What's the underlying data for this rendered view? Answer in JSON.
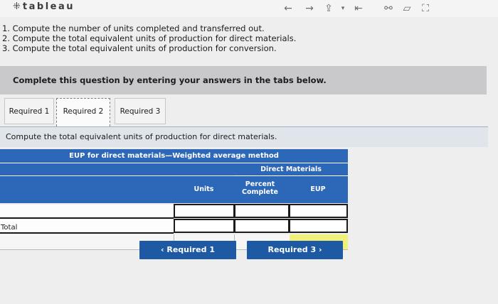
{
  "toolbar": {
    "brand": "tableau",
    "icons": [
      "back-arrow-icon",
      "forward-arrow-icon",
      "share-icon",
      "dropdown-icon",
      "collapse-icon",
      "collaborate-icon",
      "comment-icon",
      "fullscreen-icon"
    ]
  },
  "instructions": {
    "items": [
      "1. Compute the number of units completed and transferred out.",
      "2. Compute the total equivalent units of production for direct materials.",
      "3. Compute the total equivalent units of production for conversion."
    ]
  },
  "banner": {
    "text": "Complete this question by entering your answers in the tabs below."
  },
  "tabs": [
    {
      "label": "Required 1"
    },
    {
      "label": "Required 2"
    },
    {
      "label": "Required 3"
    }
  ],
  "task": {
    "text": "Compute the total equivalent units of production for direct materials."
  },
  "table": {
    "title": "EUP for direct materials—Weighted average method",
    "group_header": "Direct Materials",
    "columns": {
      "units": "Units",
      "percent": "Percent Complete",
      "eup": "EUP"
    },
    "total_label": "Total",
    "colors": {
      "header": "#2c67b8",
      "highlight": "#f0f07a"
    }
  },
  "nav": {
    "prev": "‹  Required 1",
    "next": "Required 3  ›"
  }
}
